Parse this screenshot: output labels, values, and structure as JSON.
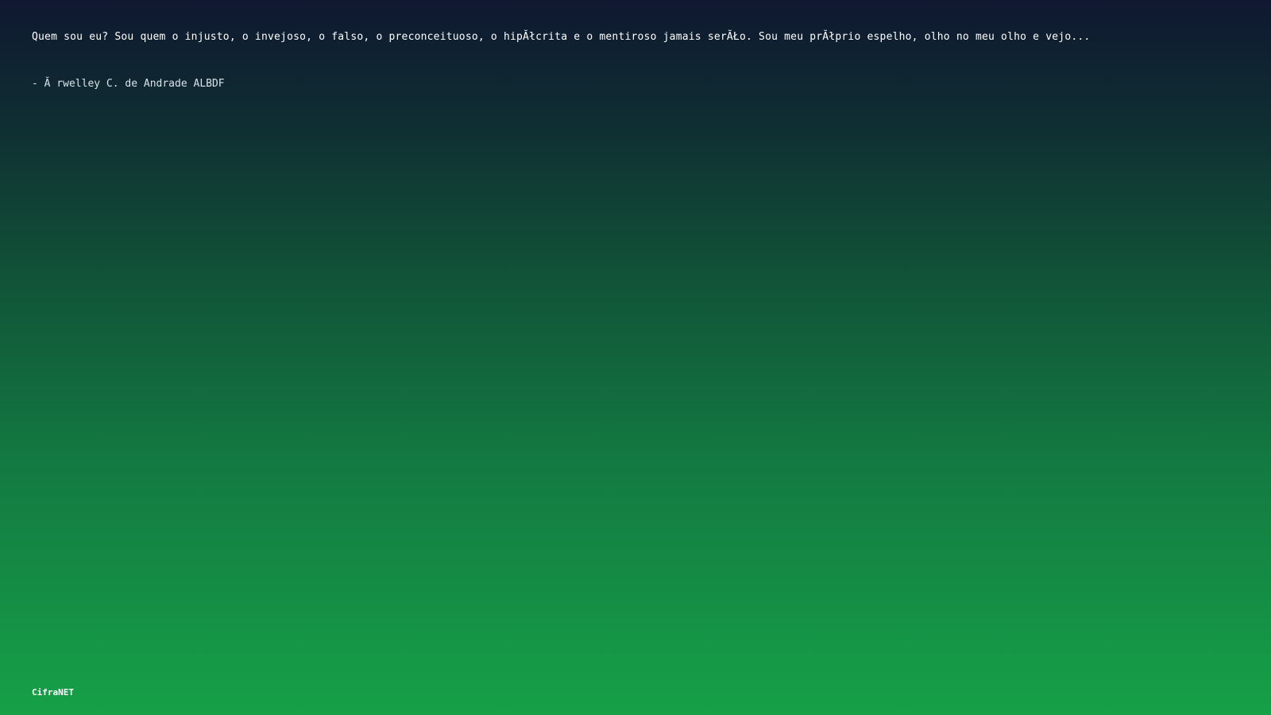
{
  "quote": {
    "text": "Quem sou eu? Sou quem o injusto, o invejoso, o falso, o preconceituoso, o hipĂłcrita e o mentiroso jamais serĂŁo. Sou meu prĂłprio espelho, olho no meu olho e vejo...",
    "author": "- Ă rwelley C. de Andrade ALBDF"
  },
  "footer": {
    "brand": "CifraNET"
  }
}
